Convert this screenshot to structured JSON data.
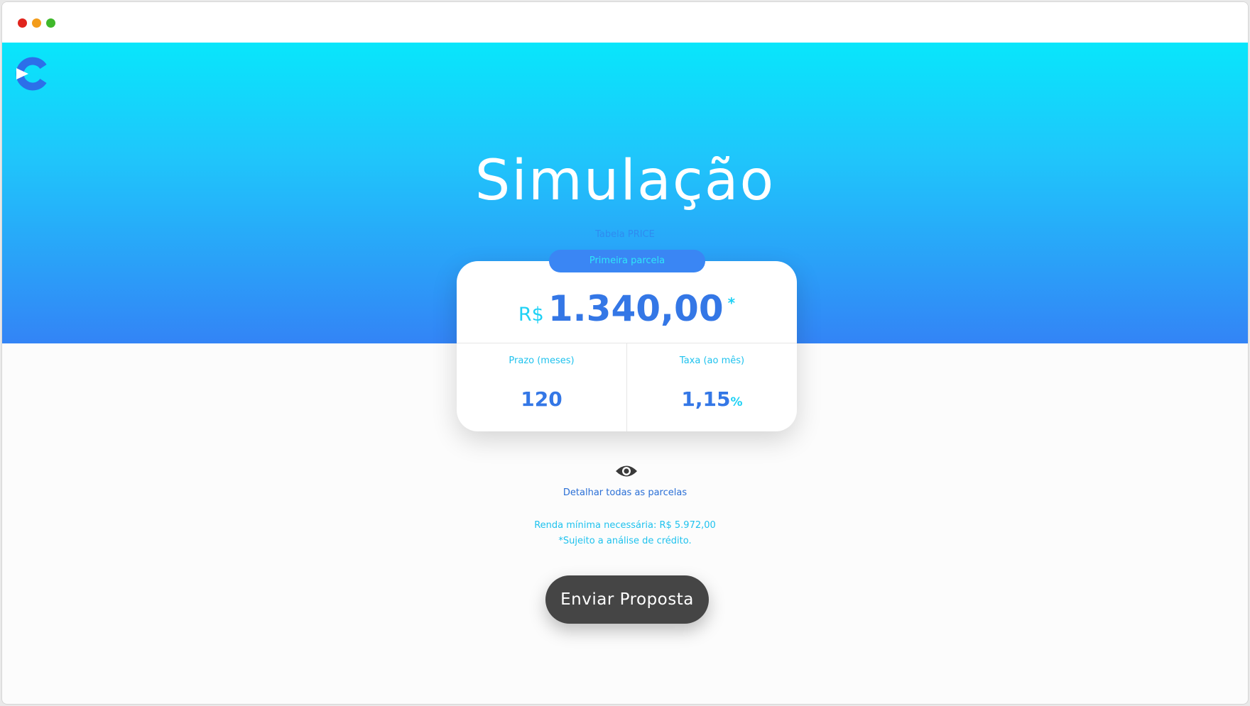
{
  "header": {
    "title": "Simulação",
    "subtitle": "Tabela PRICE"
  },
  "card": {
    "badge": "Primeira parcela",
    "currency": "R$",
    "amount": "1.340,00",
    "asterisk": "*",
    "term": {
      "label": "Prazo (meses)",
      "value": "120"
    },
    "rate": {
      "label": "Taxa (ao mês)",
      "value": "1,15",
      "unit": "%"
    }
  },
  "details_link": "Detalhar todas as parcelas",
  "info": {
    "min_income": "Renda mínima necessária: R$ 5.972,00",
    "disclaimer": "*Sujeito a análise de crédito."
  },
  "send_button": "Enviar Proposta",
  "icons": {
    "logo": "brand-logo",
    "details": "eye-icon"
  },
  "colors": {
    "gradient_top": "#08e6fb",
    "gradient_bottom": "#3384f6",
    "primary_blue": "#3477e6",
    "accent_cyan": "#1fd1f5",
    "button_dark": "#454545"
  }
}
